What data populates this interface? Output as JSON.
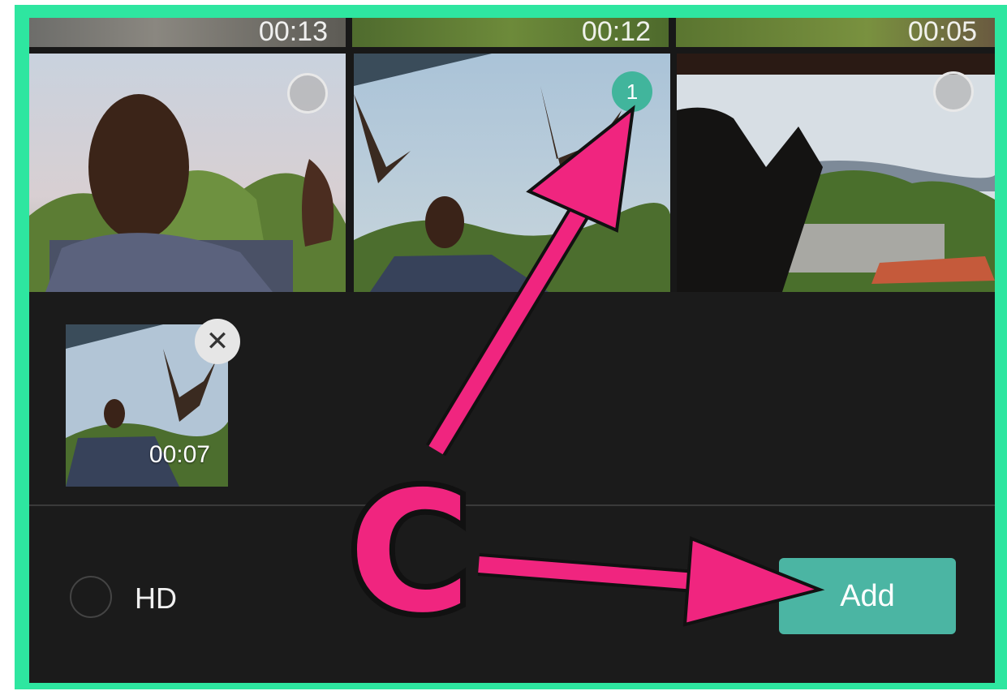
{
  "gallery": {
    "top_row_durations": [
      "00:13",
      "00:12",
      "00:05"
    ],
    "selected_index_label": "1"
  },
  "tray": {
    "clip_duration": "00:07",
    "remove_glyph": "✕"
  },
  "bottom_bar": {
    "hd_label": "HD",
    "add_label": "Add"
  },
  "annotation": {
    "letter": "C",
    "color": "#f0257f",
    "frame_color": "#2ee6a0"
  },
  "colors": {
    "accent": "#4bb5a3",
    "selection": "#41b59c",
    "background": "#181818"
  }
}
